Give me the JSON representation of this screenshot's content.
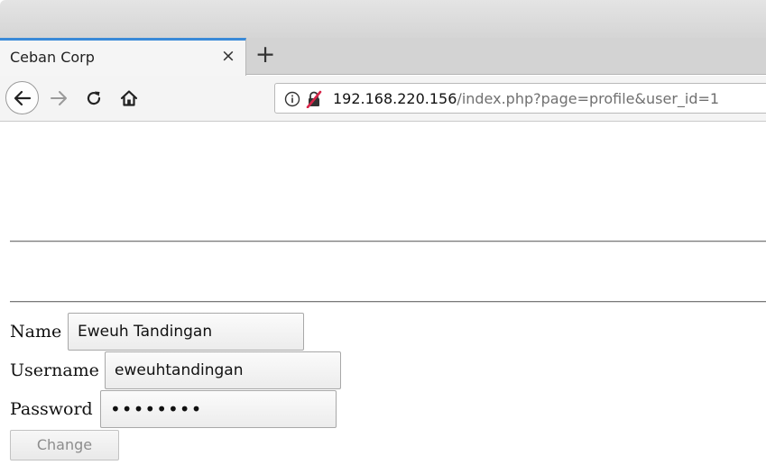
{
  "tab": {
    "title": "Ceban Corp",
    "close": "×",
    "new_tab": "+"
  },
  "nav": {
    "back_icon": "arrow-left-icon",
    "forward_icon": "arrow-right-icon",
    "reload_icon": "reload-icon",
    "home_icon": "home-icon"
  },
  "urlbar": {
    "host": "192.168.220.156",
    "path": "/index.php?page=profile&user_id=1",
    "info_icon": "info-icon",
    "insecure_icon": "insecure-lock-icon"
  },
  "form": {
    "name_label": "Name",
    "name_value": "Eweuh Tandingan",
    "username_label": "Username",
    "username_value": "eweuhtandingan",
    "password_label": "Password",
    "password_value": "••••••••",
    "submit_label": "Change"
  },
  "colors": {
    "tab_accent": "#3a8ad8",
    "insecure_red": "#d7264a"
  }
}
